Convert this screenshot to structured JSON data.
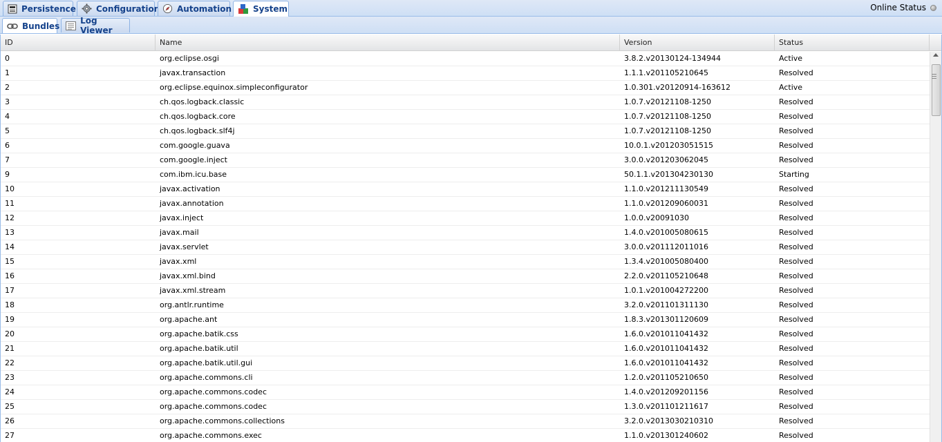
{
  "tabs": {
    "persistence": "Persistence",
    "configuration": "Configuration",
    "automation": "Automation",
    "system": "System"
  },
  "online_status": "Online Status",
  "subtabs": {
    "bundles": "Bundles",
    "log_viewer": "Log Viewer"
  },
  "grid": {
    "columns": [
      "ID",
      "Name",
      "Version",
      "Status"
    ],
    "rows": [
      [
        "0",
        "org.eclipse.osgi",
        "3.8.2.v20130124-134944",
        "Active"
      ],
      [
        "1",
        "javax.transaction",
        "1.1.1.v201105210645",
        "Resolved"
      ],
      [
        "2",
        "org.eclipse.equinox.simpleconfigurator",
        "1.0.301.v20120914-163612",
        "Active"
      ],
      [
        "3",
        "ch.qos.logback.classic",
        "1.0.7.v20121108-1250",
        "Resolved"
      ],
      [
        "4",
        "ch.qos.logback.core",
        "1.0.7.v20121108-1250",
        "Resolved"
      ],
      [
        "5",
        "ch.qos.logback.slf4j",
        "1.0.7.v20121108-1250",
        "Resolved"
      ],
      [
        "6",
        "com.google.guava",
        "10.0.1.v201203051515",
        "Resolved"
      ],
      [
        "7",
        "com.google.inject",
        "3.0.0.v201203062045",
        "Resolved"
      ],
      [
        "9",
        "com.ibm.icu.base",
        "50.1.1.v201304230130",
        "Starting"
      ],
      [
        "10",
        "javax.activation",
        "1.1.0.v201211130549",
        "Resolved"
      ],
      [
        "11",
        "javax.annotation",
        "1.1.0.v201209060031",
        "Resolved"
      ],
      [
        "12",
        "javax.inject",
        "1.0.0.v20091030",
        "Resolved"
      ],
      [
        "13",
        "javax.mail",
        "1.4.0.v201005080615",
        "Resolved"
      ],
      [
        "14",
        "javax.servlet",
        "3.0.0.v201112011016",
        "Resolved"
      ],
      [
        "15",
        "javax.xml",
        "1.3.4.v201005080400",
        "Resolved"
      ],
      [
        "16",
        "javax.xml.bind",
        "2.2.0.v201105210648",
        "Resolved"
      ],
      [
        "17",
        "javax.xml.stream",
        "1.0.1.v201004272200",
        "Resolved"
      ],
      [
        "18",
        "org.antlr.runtime",
        "3.2.0.v201101311130",
        "Resolved"
      ],
      [
        "19",
        "org.apache.ant",
        "1.8.3.v201301120609",
        "Resolved"
      ],
      [
        "20",
        "org.apache.batik.css",
        "1.6.0.v201011041432",
        "Resolved"
      ],
      [
        "21",
        "org.apache.batik.util",
        "1.6.0.v201011041432",
        "Resolved"
      ],
      [
        "22",
        "org.apache.batik.util.gui",
        "1.6.0.v201011041432",
        "Resolved"
      ],
      [
        "23",
        "org.apache.commons.cli",
        "1.2.0.v201105210650",
        "Resolved"
      ],
      [
        "24",
        "org.apache.commons.codec",
        "1.4.0.v201209201156",
        "Resolved"
      ],
      [
        "25",
        "org.apache.commons.codec",
        "1.3.0.v201101211617",
        "Resolved"
      ],
      [
        "26",
        "org.apache.commons.collections",
        "3.2.0.v201303021031​0",
        "Resolved"
      ],
      [
        "27",
        "org.apache.commons.exec",
        "1.1.0.v201301240602",
        "Resolved"
      ]
    ]
  }
}
